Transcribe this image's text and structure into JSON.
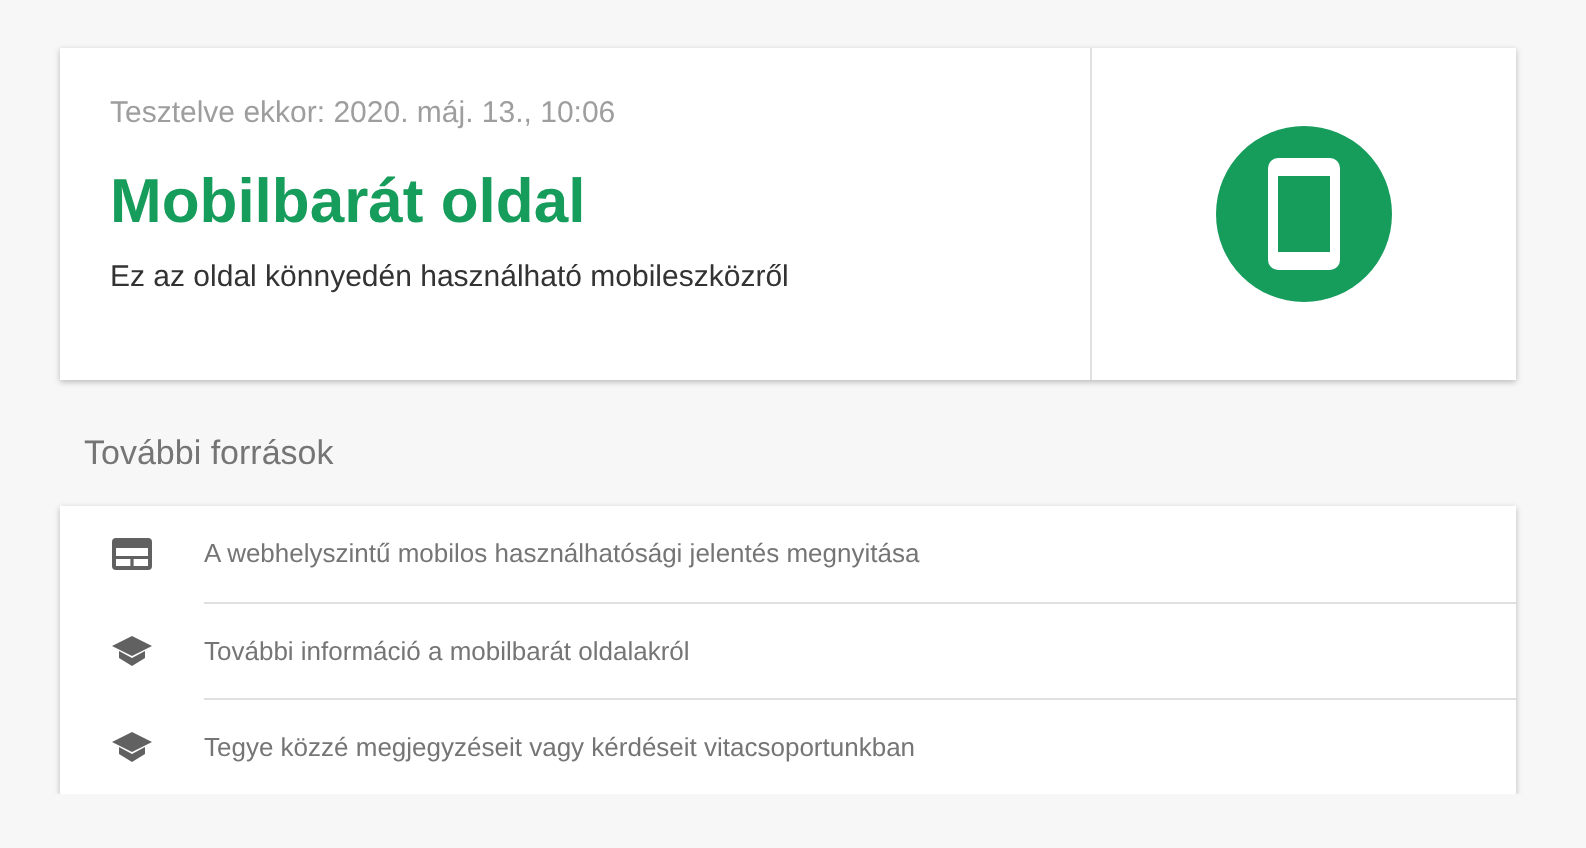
{
  "result": {
    "tested_at": "Tesztelve ekkor: 2020. máj. 13., 10:06",
    "title": "Mobilbarát oldal",
    "description": "Ez az oldal könnyedén használható mobileszközről",
    "passed": true
  },
  "resources": {
    "heading": "További források",
    "items": [
      {
        "kind": "report",
        "label": "A webhelyszintű mobilos használhatósági jelentés megnyitása"
      },
      {
        "kind": "learn",
        "label": "További információ a mobilbarát oldalakról"
      },
      {
        "kind": "learn",
        "label": "Tegye közzé megjegyzéseit vagy kérdéseit vitacsoportunkban"
      }
    ]
  }
}
